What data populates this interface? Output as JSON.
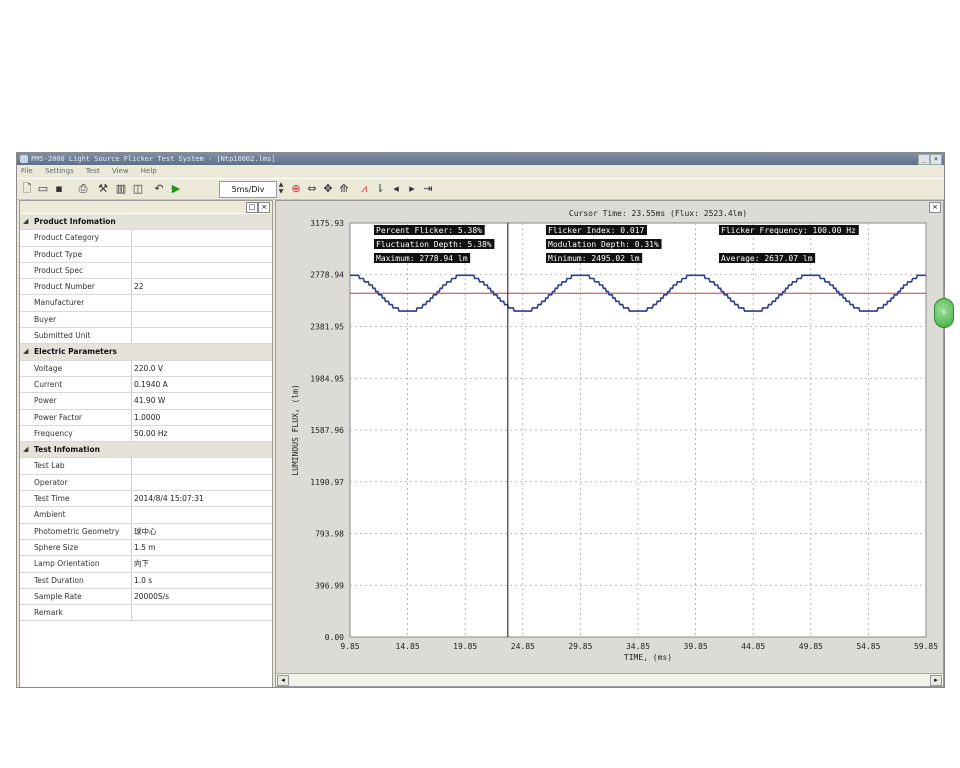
{
  "window": {
    "title": "PMS-2000 Light Source Flicker Test System - [Ntp10002.lms]",
    "controls": [
      "_",
      "×"
    ]
  },
  "menu": [
    "File",
    "Settings",
    "Test",
    "View",
    "Help"
  ],
  "toolbar": {
    "time_div": "5ms/Div",
    "icons": [
      "new-icon",
      "open-icon",
      "save-icon",
      "print-icon",
      "tools-icon",
      "chart-icon",
      "window-icon",
      "undo-icon",
      "play-icon"
    ],
    "chart_tools": [
      "zoom-icon",
      "cursor-icon",
      "pan-icon",
      "move-icon",
      "fit-icon",
      "peak-icon",
      "step-icon",
      "prev-icon",
      "next-icon",
      "end-icon"
    ]
  },
  "properties": [
    {
      "category": "Product Infomation",
      "items": [
        {
          "k": "Product Category",
          "v": ""
        },
        {
          "k": "Product Type",
          "v": ""
        },
        {
          "k": "Product Spec",
          "v": ""
        },
        {
          "k": "Product Number",
          "v": "22"
        },
        {
          "k": "Manufacturer",
          "v": ""
        },
        {
          "k": "Buyer",
          "v": ""
        },
        {
          "k": "Submitted Unit",
          "v": ""
        }
      ]
    },
    {
      "category": "Electric Parameters",
      "items": [
        {
          "k": "Voltage",
          "v": "220.0 V"
        },
        {
          "k": "Current",
          "v": "0.1940 A"
        },
        {
          "k": "Power",
          "v": "41.90 W"
        },
        {
          "k": "Power Factor",
          "v": "1.0000"
        },
        {
          "k": "Frequency",
          "v": "50.00 Hz"
        }
      ]
    },
    {
      "category": "Test Infomation",
      "items": [
        {
          "k": "Test Lab",
          "v": ""
        },
        {
          "k": "Operator",
          "v": ""
        },
        {
          "k": "Test Time",
          "v": "2014/8/4 15:07:31"
        },
        {
          "k": "Ambient",
          "v": ""
        },
        {
          "k": "Photometric Geometry",
          "v": "球中心"
        },
        {
          "k": "Sphere Size",
          "v": "1.5 m"
        },
        {
          "k": "Lamp Orientation",
          "v": "向下"
        },
        {
          "k": "Test Duration",
          "v": "1.0 s"
        },
        {
          "k": "Sample Rate",
          "v": "20000S/s"
        },
        {
          "k": "Remark",
          "v": ""
        }
      ]
    }
  ],
  "chart": {
    "cursor_text": "Cursor Time: 23.55ms (Flux: 2523.4lm)",
    "stats": [
      "Percent Flicker: 5.38%",
      "Flicker Index: 0.017",
      "Flicker Frequency: 100.00 Hz",
      "Fluctuation Depth: 5.38%",
      "Modulation Depth: 0.31%",
      "Maximum: 2778.94 lm",
      "Minimum: 2495.02 lm",
      "Average: 2637.07 lm"
    ]
  },
  "chart_data": {
    "type": "line",
    "title": "",
    "xlabel": "TIME, (ms)",
    "ylabel": "LUMINOUS FLUX, (lm)",
    "xlim": [
      9.85,
      59.85
    ],
    "ylim": [
      0.0,
      3175.93
    ],
    "x_ticks": [
      "9.85",
      "14.85",
      "19.85",
      "24.85",
      "29.85",
      "34.85",
      "39.85",
      "44.85",
      "49.85",
      "54.85",
      "59.85"
    ],
    "y_ticks": [
      "0.00",
      "396.99",
      "793.98",
      "1190.97",
      "1587.96",
      "1984.95",
      "2381.95",
      "2778.94",
      "3175.93"
    ],
    "grid": true,
    "series": [
      {
        "period_ms": 10.0,
        "max": 2778.94,
        "min": 2495.02,
        "first_peak_ms": 9.85,
        "color": "#2b3d8f"
      }
    ],
    "average_line": {
      "value": 2637.07,
      "color": "#c83a3a"
    },
    "cursor": {
      "x": 23.55,
      "color": "#111111"
    }
  }
}
